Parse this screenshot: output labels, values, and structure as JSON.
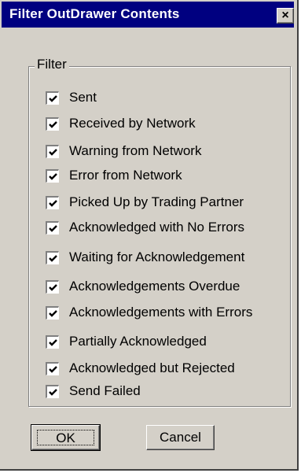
{
  "window": {
    "title": "Filter OutDrawer Contents",
    "close_glyph": "×"
  },
  "filter_group": {
    "label": "Filter",
    "items": [
      {
        "label": "Sent",
        "checked": true
      },
      {
        "label": "Received by Network",
        "checked": true
      },
      {
        "label": "Warning from Network",
        "checked": true
      },
      {
        "label": "Error from Network",
        "checked": true
      },
      {
        "label": "Picked Up by Trading Partner",
        "checked": true
      },
      {
        "label": "Acknowledged with No Errors",
        "checked": true
      },
      {
        "label": "Waiting for Acknowledgement",
        "checked": true
      },
      {
        "label": "Acknowledgements Overdue",
        "checked": true
      },
      {
        "label": "Acknowledgements with Errors",
        "checked": true
      },
      {
        "label": "Partially Acknowledged",
        "checked": true
      },
      {
        "label": "Acknowledged but Rejected",
        "checked": true
      },
      {
        "label": "Send Failed",
        "checked": true
      }
    ]
  },
  "buttons": {
    "ok": "OK",
    "cancel": "Cancel"
  },
  "colors": {
    "titlebar": "#000080",
    "face": "#d4d0c8"
  }
}
